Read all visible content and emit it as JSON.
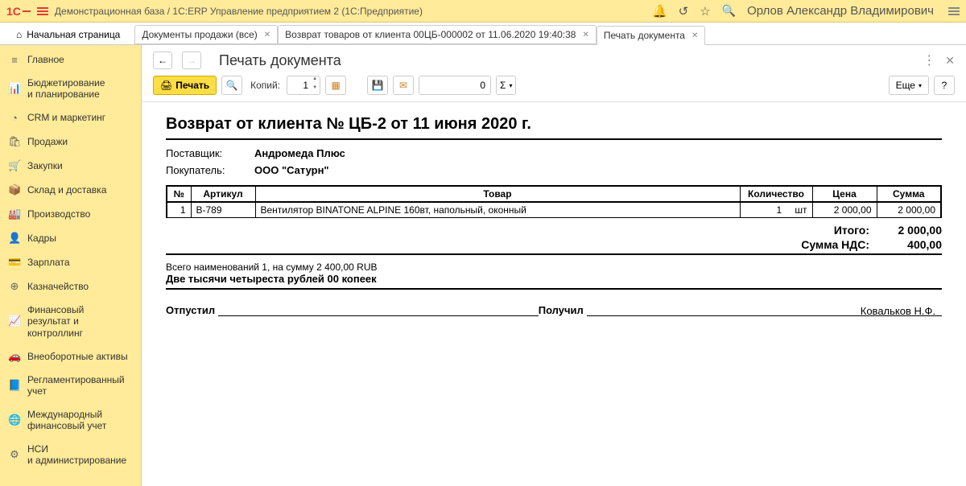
{
  "app": {
    "logo_text": "1С",
    "title": "Демонстрационная база / 1С:ERP Управление предприятием 2   (1С:Предприятие)",
    "user": "Орлов Александр Владимирович"
  },
  "tabs": {
    "home": "Начальная страница",
    "t1": "Документы продажи (все)",
    "t2": "Возврат товаров от клиента 00ЦБ-000002 от 11.06.2020 19:40:38",
    "t3": "Печать документа"
  },
  "sidebar": [
    {
      "icon": "≡",
      "label": "Главное"
    },
    {
      "icon": "📊",
      "label": "Бюджетирование\nи планирование"
    },
    {
      "icon": "◔",
      "label": "CRM и маркетинг"
    },
    {
      "icon": "🛍",
      "label": "Продажи"
    },
    {
      "icon": "🛒",
      "label": "Закупки"
    },
    {
      "icon": "📦",
      "label": "Склад и доставка"
    },
    {
      "icon": "🏭",
      "label": "Производство"
    },
    {
      "icon": "👤",
      "label": "Кадры"
    },
    {
      "icon": "💳",
      "label": "Зарплата"
    },
    {
      "icon": "⊕",
      "label": "Казначейство"
    },
    {
      "icon": "📈",
      "label": "Финансовый\nрезультат и контроллинг"
    },
    {
      "icon": "🚗",
      "label": "Внеоборотные активы"
    },
    {
      "icon": "📘",
      "label": "Регламентированный\nучет"
    },
    {
      "icon": "🌐",
      "label": "Международный\nфинансовый учет"
    },
    {
      "icon": "⚙",
      "label": "НСИ\nи администрирование"
    }
  ],
  "page": {
    "title": "Печать документа"
  },
  "toolbar": {
    "print": "Печать",
    "copies_label": "Копий:",
    "copies_value": "1",
    "zero_value": "0",
    "sigma": "Σ",
    "more": "Еще",
    "help": "?"
  },
  "doc": {
    "title": "Возврат от клиента № ЦБ-2 от 11 июня 2020 г.",
    "supplier_label": "Поставщик:",
    "supplier": "Андромеда Плюс",
    "buyer_label": "Покупатель:",
    "buyer": "ООО \"Сатурн\"",
    "cols": {
      "no": "№",
      "art": "Артикул",
      "name": "Товар",
      "qty": "Количество",
      "price": "Цена",
      "sum": "Сумма"
    },
    "rows": [
      {
        "no": "1",
        "art": "В-789",
        "name": "Вентилятор BINATONE ALPINE 160вт, напольный, оконный",
        "qty": "1",
        "unit": "шт",
        "price": "2 000,00",
        "sum": "2 000,00"
      }
    ],
    "totals": {
      "total_label": "Итого:",
      "total": "2 000,00",
      "vat_label": "Сумма НДС:",
      "vat": "400,00"
    },
    "summary_count": "Всего наименований 1, на сумму 2 400,00 RUB",
    "summary_words": "Две тысячи четыреста рублей 00 копеек",
    "released_label": "Отпустил",
    "received_label": "Получил",
    "received_name": "Ковальков Н.Ф."
  }
}
